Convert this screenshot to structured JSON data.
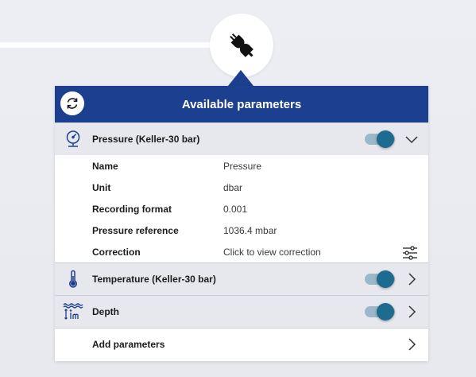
{
  "connection": {
    "icon": "plug-connected-icon"
  },
  "panel": {
    "title": "Available parameters",
    "refresh_icon": "refresh-icon"
  },
  "parameters": [
    {
      "label": "Pressure (Keller-30 bar)",
      "icon": "gauge-icon",
      "enabled": true,
      "expanded": true,
      "details": [
        {
          "key": "Name",
          "value": "Pressure"
        },
        {
          "key": "Unit",
          "value": "dbar"
        },
        {
          "key": "Recording format",
          "value": "0.001"
        },
        {
          "key": "Pressure reference",
          "value": "1036.4 mbar"
        },
        {
          "key": "Correction",
          "value": "Click to view correction"
        }
      ]
    },
    {
      "label": "Temperature (Keller-30 bar)",
      "icon": "thermometer-icon",
      "enabled": true,
      "expanded": false
    },
    {
      "label": "Depth",
      "icon": "depth-icon",
      "enabled": true,
      "expanded": false
    }
  ],
  "add_parameters": {
    "label": "Add parameters"
  },
  "colors": {
    "header": "#1d3f8f",
    "toggle_on": "#1d6c8f",
    "row_bg": "#e7e8ed"
  }
}
